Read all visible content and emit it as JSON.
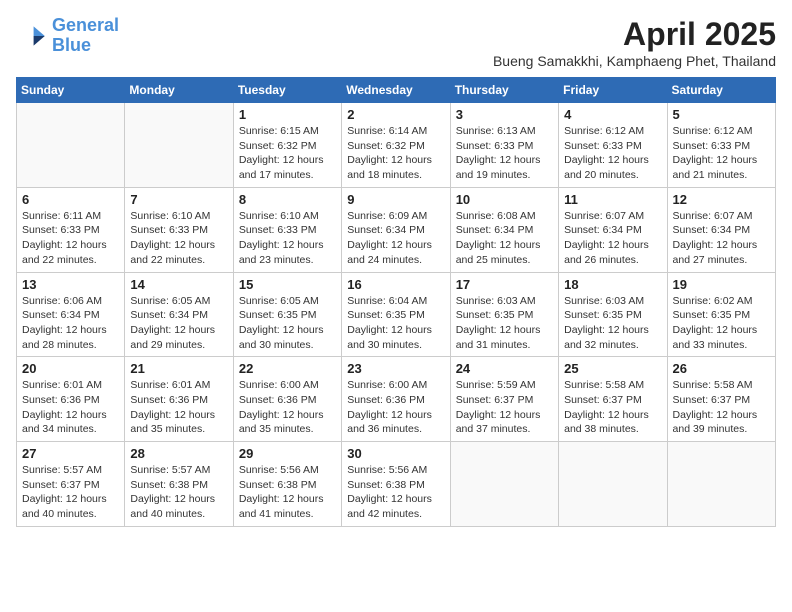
{
  "header": {
    "logo_line1": "General",
    "logo_line2": "Blue",
    "month_title": "April 2025",
    "subtitle": "Bueng Samakkhi, Kamphaeng Phet, Thailand"
  },
  "days_of_week": [
    "Sunday",
    "Monday",
    "Tuesday",
    "Wednesday",
    "Thursday",
    "Friday",
    "Saturday"
  ],
  "weeks": [
    [
      {
        "day": "",
        "info": ""
      },
      {
        "day": "",
        "info": ""
      },
      {
        "day": "1",
        "sunrise": "6:15 AM",
        "sunset": "6:32 PM",
        "daylight": "12 hours and 17 minutes."
      },
      {
        "day": "2",
        "sunrise": "6:14 AM",
        "sunset": "6:32 PM",
        "daylight": "12 hours and 18 minutes."
      },
      {
        "day": "3",
        "sunrise": "6:13 AM",
        "sunset": "6:33 PM",
        "daylight": "12 hours and 19 minutes."
      },
      {
        "day": "4",
        "sunrise": "6:12 AM",
        "sunset": "6:33 PM",
        "daylight": "12 hours and 20 minutes."
      },
      {
        "day": "5",
        "sunrise": "6:12 AM",
        "sunset": "6:33 PM",
        "daylight": "12 hours and 21 minutes."
      }
    ],
    [
      {
        "day": "6",
        "sunrise": "6:11 AM",
        "sunset": "6:33 PM",
        "daylight": "12 hours and 22 minutes."
      },
      {
        "day": "7",
        "sunrise": "6:10 AM",
        "sunset": "6:33 PM",
        "daylight": "12 hours and 22 minutes."
      },
      {
        "day": "8",
        "sunrise": "6:10 AM",
        "sunset": "6:33 PM",
        "daylight": "12 hours and 23 minutes."
      },
      {
        "day": "9",
        "sunrise": "6:09 AM",
        "sunset": "6:34 PM",
        "daylight": "12 hours and 24 minutes."
      },
      {
        "day": "10",
        "sunrise": "6:08 AM",
        "sunset": "6:34 PM",
        "daylight": "12 hours and 25 minutes."
      },
      {
        "day": "11",
        "sunrise": "6:07 AM",
        "sunset": "6:34 PM",
        "daylight": "12 hours and 26 minutes."
      },
      {
        "day": "12",
        "sunrise": "6:07 AM",
        "sunset": "6:34 PM",
        "daylight": "12 hours and 27 minutes."
      }
    ],
    [
      {
        "day": "13",
        "sunrise": "6:06 AM",
        "sunset": "6:34 PM",
        "daylight": "12 hours and 28 minutes."
      },
      {
        "day": "14",
        "sunrise": "6:05 AM",
        "sunset": "6:34 PM",
        "daylight": "12 hours and 29 minutes."
      },
      {
        "day": "15",
        "sunrise": "6:05 AM",
        "sunset": "6:35 PM",
        "daylight": "12 hours and 30 minutes."
      },
      {
        "day": "16",
        "sunrise": "6:04 AM",
        "sunset": "6:35 PM",
        "daylight": "12 hours and 30 minutes."
      },
      {
        "day": "17",
        "sunrise": "6:03 AM",
        "sunset": "6:35 PM",
        "daylight": "12 hours and 31 minutes."
      },
      {
        "day": "18",
        "sunrise": "6:03 AM",
        "sunset": "6:35 PM",
        "daylight": "12 hours and 32 minutes."
      },
      {
        "day": "19",
        "sunrise": "6:02 AM",
        "sunset": "6:35 PM",
        "daylight": "12 hours and 33 minutes."
      }
    ],
    [
      {
        "day": "20",
        "sunrise": "6:01 AM",
        "sunset": "6:36 PM",
        "daylight": "12 hours and 34 minutes."
      },
      {
        "day": "21",
        "sunrise": "6:01 AM",
        "sunset": "6:36 PM",
        "daylight": "12 hours and 35 minutes."
      },
      {
        "day": "22",
        "sunrise": "6:00 AM",
        "sunset": "6:36 PM",
        "daylight": "12 hours and 35 minutes."
      },
      {
        "day": "23",
        "sunrise": "6:00 AM",
        "sunset": "6:36 PM",
        "daylight": "12 hours and 36 minutes."
      },
      {
        "day": "24",
        "sunrise": "5:59 AM",
        "sunset": "6:37 PM",
        "daylight": "12 hours and 37 minutes."
      },
      {
        "day": "25",
        "sunrise": "5:58 AM",
        "sunset": "6:37 PM",
        "daylight": "12 hours and 38 minutes."
      },
      {
        "day": "26",
        "sunrise": "5:58 AM",
        "sunset": "6:37 PM",
        "daylight": "12 hours and 39 minutes."
      }
    ],
    [
      {
        "day": "27",
        "sunrise": "5:57 AM",
        "sunset": "6:37 PM",
        "daylight": "12 hours and 40 minutes."
      },
      {
        "day": "28",
        "sunrise": "5:57 AM",
        "sunset": "6:38 PM",
        "daylight": "12 hours and 40 minutes."
      },
      {
        "day": "29",
        "sunrise": "5:56 AM",
        "sunset": "6:38 PM",
        "daylight": "12 hours and 41 minutes."
      },
      {
        "day": "30",
        "sunrise": "5:56 AM",
        "sunset": "6:38 PM",
        "daylight": "12 hours and 42 minutes."
      },
      {
        "day": "",
        "info": ""
      },
      {
        "day": "",
        "info": ""
      },
      {
        "day": "",
        "info": ""
      }
    ]
  ],
  "labels": {
    "sunrise_prefix": "Sunrise: ",
    "sunset_prefix": "Sunset: ",
    "daylight_prefix": "Daylight: "
  }
}
